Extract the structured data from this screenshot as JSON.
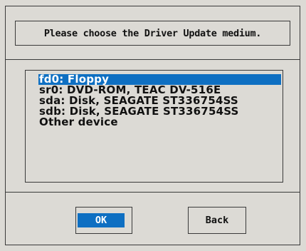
{
  "dialog": {
    "prompt": "Please choose the Driver Update medium.",
    "devices": [
      {
        "label": "fd0: Floppy",
        "selected": true
      },
      {
        "label": "sr0: DVD-ROM, TEAC DV-516E",
        "selected": false
      },
      {
        "label": "sda: Disk, SEAGATE ST336754SS",
        "selected": false
      },
      {
        "label": "sdb: Disk, SEAGATE ST336754SS",
        "selected": false
      },
      {
        "label": "Other device",
        "selected": false
      }
    ],
    "ok_label": "OK",
    "back_label": "Back"
  },
  "colors": {
    "background": "#dcdad5",
    "highlight": "#0e6fc2",
    "border": "#3a3a3a"
  }
}
